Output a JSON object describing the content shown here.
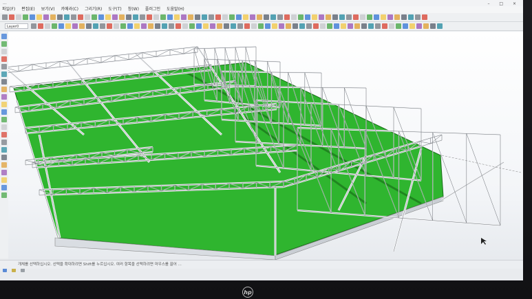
{
  "window": {
    "title": "...",
    "controls": "– □ ×"
  },
  "menu": {
    "items": [
      "파일(F)",
      "편집(E)",
      "보기(V)",
      "카메라(C)",
      "그리기(R)",
      "도구(T)",
      "창(W)",
      "플러그인",
      "도움말(H)"
    ]
  },
  "toolbar": {
    "layer_label": "Layer0"
  },
  "statusbar": {
    "hint": "개체를 선택하십시오. 선택을 확대하려면 Shift를 누르십시오. 여러 항목을 선택하려면 마우스를 끌어 ..."
  },
  "device": {
    "brand": "hp"
  },
  "colors": {
    "ground": "#2fb52f",
    "truss": "#e8eaec",
    "sky": "#ffffff"
  }
}
